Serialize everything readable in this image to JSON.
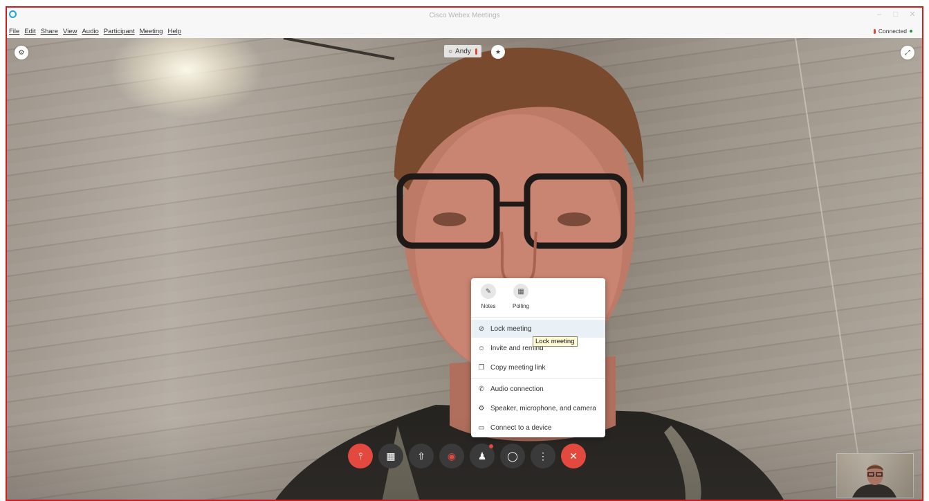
{
  "window": {
    "title": "Cisco Webex Meetings"
  },
  "menubar": {
    "items": [
      "File",
      "Edit",
      "Share",
      "View",
      "Audio",
      "Participant",
      "Meeting",
      "Help"
    ]
  },
  "status": {
    "label": "Connected"
  },
  "speaker": {
    "name": "Andy"
  },
  "more_menu": {
    "quick_actions": [
      {
        "label": "Notes",
        "icon": "notes-icon"
      },
      {
        "label": "Polling",
        "icon": "polling-icon"
      }
    ],
    "items": [
      {
        "label": "Lock meeting",
        "icon": "lock-icon",
        "highlighted": true
      },
      {
        "label": "Invite and remind",
        "icon": "invite-icon"
      },
      {
        "label": "Copy meeting link",
        "icon": "copy-icon"
      },
      {
        "label": "Audio connection",
        "icon": "phone-icon"
      },
      {
        "label": "Speaker, microphone, and camera",
        "icon": "gear-icon"
      },
      {
        "label": "Connect to a device",
        "icon": "device-icon"
      }
    ]
  },
  "tooltip": {
    "text": "Lock meeting"
  },
  "controls": [
    {
      "name": "mute-button",
      "icon": "mic-muted-icon",
      "color": "#e3493e"
    },
    {
      "name": "video-button",
      "icon": "video-icon"
    },
    {
      "name": "share-button",
      "icon": "share-icon"
    },
    {
      "name": "record-button",
      "icon": "record-icon"
    },
    {
      "name": "participants-button",
      "icon": "participants-icon"
    },
    {
      "name": "chat-button",
      "icon": "chat-icon"
    },
    {
      "name": "more-options-button",
      "icon": "more-icon"
    },
    {
      "name": "leave-meeting-button",
      "icon": "close-icon",
      "color": "#e3493e"
    }
  ],
  "colors": {
    "frame_border": "#d01c1c",
    "accent_red": "#e3493e",
    "connected_green": "#1b9b3e"
  }
}
